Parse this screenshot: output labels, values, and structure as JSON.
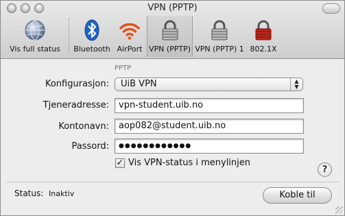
{
  "window": {
    "title": "VPN (PPTP)"
  },
  "toolbar": {
    "items": [
      {
        "label": "Vis full status",
        "icon": "network-globe-icon"
      },
      {
        "label": "Bluetooth",
        "icon": "bluetooth-icon"
      },
      {
        "label": "AirPort",
        "icon": "airport-wifi-icon"
      },
      {
        "label": "VPN (PPTP)",
        "icon": "lock-icon",
        "selected": true
      },
      {
        "label": "VPN (PPTP) 1",
        "icon": "lock-icon"
      },
      {
        "label": "802.1X",
        "icon": "lock-icon"
      }
    ]
  },
  "form": {
    "section_label": "PPTP",
    "config_label": "Konfigurasjon:",
    "config_value": "UiB VPN",
    "server_label": "Tjeneradresse:",
    "server_value": "vpn-student.uib.no",
    "account_label": "Kontonavn:",
    "account_value": "aop082@student.uib.no",
    "password_label": "Passord:",
    "password_value": "●●●●●●●●●●●●",
    "show_status_label": "Vis VPN-status i menylinjen",
    "show_status_checked": true,
    "help_glyph": "?"
  },
  "footer": {
    "status_label": "Status:",
    "status_value": "Inaktiv",
    "connect_label": "Koble til"
  },
  "colors": {
    "bluetooth": "#1e62c8",
    "airport": "#e0531f",
    "lock_red": "#c0261c"
  }
}
